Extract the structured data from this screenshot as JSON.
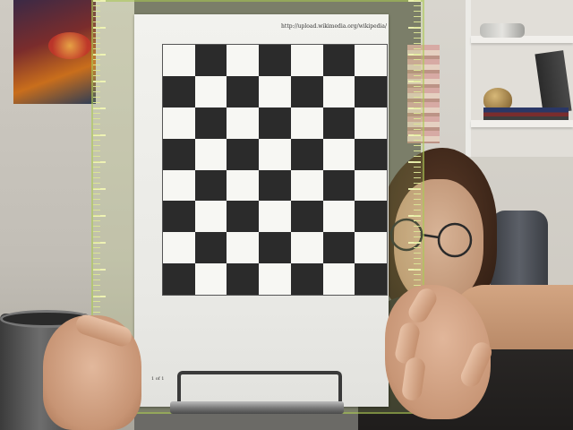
{
  "scene": {
    "document": {
      "url_text": "http://upload.wikimedia.org/wikipedia/",
      "page_text": "1 of 1",
      "checkerboard": {
        "columns": 7,
        "rows": 8,
        "first_square": "light"
      }
    },
    "colors": {
      "dark_square": "#2b2b2b",
      "light_square": "#f7f7f3",
      "ruler_tint": "#b4cc5a"
    }
  }
}
